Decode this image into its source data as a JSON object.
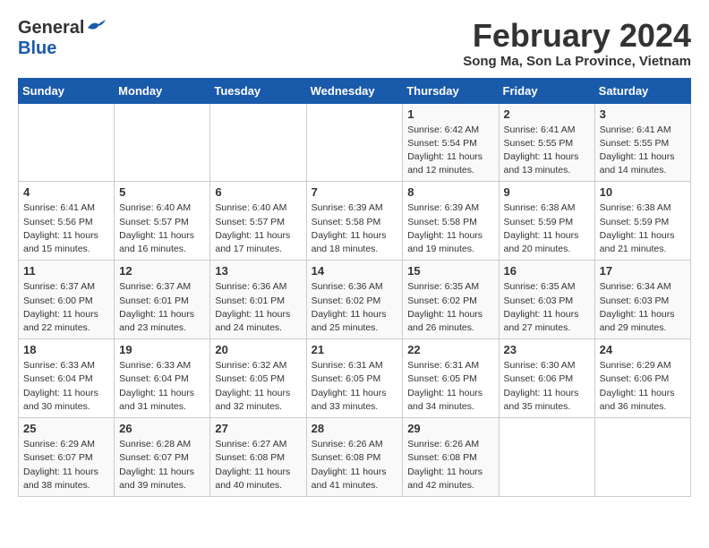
{
  "header": {
    "logo_general": "General",
    "logo_blue": "Blue",
    "title": "February 2024",
    "subtitle": "Song Ma, Son La Province, Vietnam"
  },
  "weekdays": [
    "Sunday",
    "Monday",
    "Tuesday",
    "Wednesday",
    "Thursday",
    "Friday",
    "Saturday"
  ],
  "weeks": [
    [
      {
        "day": "",
        "info": ""
      },
      {
        "day": "",
        "info": ""
      },
      {
        "day": "",
        "info": ""
      },
      {
        "day": "",
        "info": ""
      },
      {
        "day": "1",
        "info": "Sunrise: 6:42 AM\nSunset: 5:54 PM\nDaylight: 11 hours\nand 12 minutes."
      },
      {
        "day": "2",
        "info": "Sunrise: 6:41 AM\nSunset: 5:55 PM\nDaylight: 11 hours\nand 13 minutes."
      },
      {
        "day": "3",
        "info": "Sunrise: 6:41 AM\nSunset: 5:55 PM\nDaylight: 11 hours\nand 14 minutes."
      }
    ],
    [
      {
        "day": "4",
        "info": "Sunrise: 6:41 AM\nSunset: 5:56 PM\nDaylight: 11 hours\nand 15 minutes."
      },
      {
        "day": "5",
        "info": "Sunrise: 6:40 AM\nSunset: 5:57 PM\nDaylight: 11 hours\nand 16 minutes."
      },
      {
        "day": "6",
        "info": "Sunrise: 6:40 AM\nSunset: 5:57 PM\nDaylight: 11 hours\nand 17 minutes."
      },
      {
        "day": "7",
        "info": "Sunrise: 6:39 AM\nSunset: 5:58 PM\nDaylight: 11 hours\nand 18 minutes."
      },
      {
        "day": "8",
        "info": "Sunrise: 6:39 AM\nSunset: 5:58 PM\nDaylight: 11 hours\nand 19 minutes."
      },
      {
        "day": "9",
        "info": "Sunrise: 6:38 AM\nSunset: 5:59 PM\nDaylight: 11 hours\nand 20 minutes."
      },
      {
        "day": "10",
        "info": "Sunrise: 6:38 AM\nSunset: 5:59 PM\nDaylight: 11 hours\nand 21 minutes."
      }
    ],
    [
      {
        "day": "11",
        "info": "Sunrise: 6:37 AM\nSunset: 6:00 PM\nDaylight: 11 hours\nand 22 minutes."
      },
      {
        "day": "12",
        "info": "Sunrise: 6:37 AM\nSunset: 6:01 PM\nDaylight: 11 hours\nand 23 minutes."
      },
      {
        "day": "13",
        "info": "Sunrise: 6:36 AM\nSunset: 6:01 PM\nDaylight: 11 hours\nand 24 minutes."
      },
      {
        "day": "14",
        "info": "Sunrise: 6:36 AM\nSunset: 6:02 PM\nDaylight: 11 hours\nand 25 minutes."
      },
      {
        "day": "15",
        "info": "Sunrise: 6:35 AM\nSunset: 6:02 PM\nDaylight: 11 hours\nand 26 minutes."
      },
      {
        "day": "16",
        "info": "Sunrise: 6:35 AM\nSunset: 6:03 PM\nDaylight: 11 hours\nand 27 minutes."
      },
      {
        "day": "17",
        "info": "Sunrise: 6:34 AM\nSunset: 6:03 PM\nDaylight: 11 hours\nand 29 minutes."
      }
    ],
    [
      {
        "day": "18",
        "info": "Sunrise: 6:33 AM\nSunset: 6:04 PM\nDaylight: 11 hours\nand 30 minutes."
      },
      {
        "day": "19",
        "info": "Sunrise: 6:33 AM\nSunset: 6:04 PM\nDaylight: 11 hours\nand 31 minutes."
      },
      {
        "day": "20",
        "info": "Sunrise: 6:32 AM\nSunset: 6:05 PM\nDaylight: 11 hours\nand 32 minutes."
      },
      {
        "day": "21",
        "info": "Sunrise: 6:31 AM\nSunset: 6:05 PM\nDaylight: 11 hours\nand 33 minutes."
      },
      {
        "day": "22",
        "info": "Sunrise: 6:31 AM\nSunset: 6:05 PM\nDaylight: 11 hours\nand 34 minutes."
      },
      {
        "day": "23",
        "info": "Sunrise: 6:30 AM\nSunset: 6:06 PM\nDaylight: 11 hours\nand 35 minutes."
      },
      {
        "day": "24",
        "info": "Sunrise: 6:29 AM\nSunset: 6:06 PM\nDaylight: 11 hours\nand 36 minutes."
      }
    ],
    [
      {
        "day": "25",
        "info": "Sunrise: 6:29 AM\nSunset: 6:07 PM\nDaylight: 11 hours\nand 38 minutes."
      },
      {
        "day": "26",
        "info": "Sunrise: 6:28 AM\nSunset: 6:07 PM\nDaylight: 11 hours\nand 39 minutes."
      },
      {
        "day": "27",
        "info": "Sunrise: 6:27 AM\nSunset: 6:08 PM\nDaylight: 11 hours\nand 40 minutes."
      },
      {
        "day": "28",
        "info": "Sunrise: 6:26 AM\nSunset: 6:08 PM\nDaylight: 11 hours\nand 41 minutes."
      },
      {
        "day": "29",
        "info": "Sunrise: 6:26 AM\nSunset: 6:08 PM\nDaylight: 11 hours\nand 42 minutes."
      },
      {
        "day": "",
        "info": ""
      },
      {
        "day": "",
        "info": ""
      }
    ]
  ]
}
